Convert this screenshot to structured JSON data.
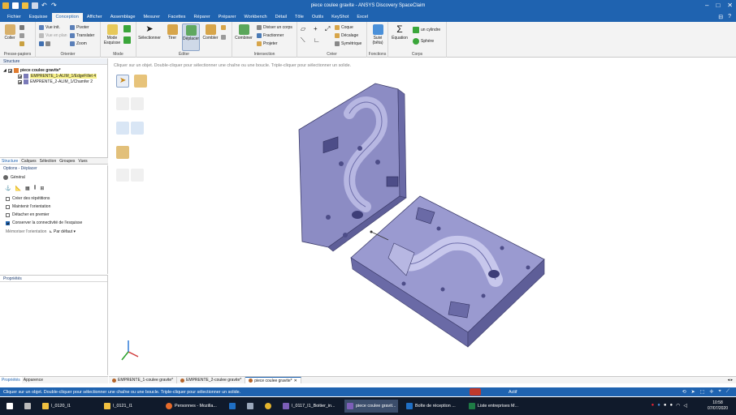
{
  "window": {
    "title": "piece coulee gravite - ANSYS Discovery SpaceClaim"
  },
  "menu": {
    "tabs": [
      "Fichier",
      "Esquisse",
      "Conception",
      "Afficher",
      "Assemblage",
      "Mesurer",
      "Facettes",
      "Réparer",
      "Préparer",
      "Workbench",
      "Détail",
      "Tôle",
      "Outils",
      "KeyShot",
      "Excel"
    ],
    "active": "Conception"
  },
  "ribbon": {
    "presse_papiers": {
      "label": "Presse-papiers",
      "coller": "Coller"
    },
    "orienter": {
      "label": "Orienter",
      "vue_init": "Vue init.",
      "pivoter": "Pivoter",
      "vue_en_plan": "Vue en plan",
      "translater": "Translater",
      "zoom": "Zoom"
    },
    "mode": {
      "label": "Mode",
      "mode_esquisse": "Mode Esquisse"
    },
    "editer": {
      "label": "Éditer",
      "selectionner": "Sélectionner",
      "tirer": "Tirer",
      "deplacer": "Déplacer",
      "combler": "Combler"
    },
    "intersection": {
      "label": "Intersection",
      "combiner": "Combiner",
      "diviser_corps": "Diviser un corps",
      "fractionner": "Fractionner",
      "projeter": "Projeter"
    },
    "creer": {
      "label": "Créer",
      "coque": "Coque",
      "decalage": "Décalage",
      "symetrique": "Symétrique"
    },
    "fonctions": {
      "label": "Fonctions",
      "suivi": "Suivi (bêta)"
    },
    "corps": {
      "label": "Corps",
      "equation": "Équation",
      "cylindre": "un cylindre",
      "sphere": "Sphère"
    }
  },
  "structure": {
    "title": "Structure",
    "root": "piece coulee gravite*",
    "items": [
      {
        "label": "EMPRENTE_1-ALIM_1/EdgeFillet 4",
        "highlighted": true
      },
      {
        "label": "EMPRENTE_2-ALIM_1/Chamfer 2",
        "highlighted": false
      }
    ]
  },
  "panel_tabs": [
    "Structure",
    "Calques",
    "Sélection",
    "Groupes",
    "Vues"
  ],
  "options": {
    "title": "Options - Déplacer",
    "section": "Général",
    "items": [
      {
        "label": "Créer des répétitions",
        "checked": false
      },
      {
        "label": "Maintenir l'orientation",
        "checked": false
      },
      {
        "label": "Détacher en premier",
        "checked": false
      },
      {
        "label": "Conserver la connectivité de l'esquisse",
        "checked": true
      }
    ],
    "memoriser_label": "Mémoriser l'orientation",
    "memoriser_value": "Par défaut"
  },
  "properties": {
    "title": "Propriétés"
  },
  "bottom_left_tabs": [
    "Propriétés",
    "Apparence"
  ],
  "viewport": {
    "hint": "Cliquer sur un objet.  Double-cliquer pour sélectionner une chaîne ou une boucle.  Triple-cliquer pour sélectionner un solide."
  },
  "doc_tabs": [
    {
      "label": "EMPRENTE_1-coulee gravite*",
      "active": false
    },
    {
      "label": "EMPRENTE_2-coulee gravite*",
      "active": false
    },
    {
      "label": "piece coulee gravite*",
      "active": true
    }
  ],
  "status": {
    "message": "Cliquer sur un objet.  Double-cliquer pour sélectionner une chaîne ou une boucle.  Triple-cliquer pour sélectionner un solide.",
    "active_label": "Actif"
  },
  "taskbar": {
    "items": [
      "I_0120_I1",
      "I_0121_I1",
      "Personnes - Mozilla...",
      "I_0117_I1_Boitier_in...",
      "piece coulee gravit...",
      "Boîte de réception ...",
      "Liste entreprises M..."
    ],
    "active": "piece coulee gravit...",
    "time": "10:58",
    "date": "07/07/2020"
  },
  "colors": {
    "titlebar": "#1f63b0",
    "part_face": "#8c8cc4",
    "part_side": "#6a6aa6",
    "highlight": "#f6f08a"
  }
}
